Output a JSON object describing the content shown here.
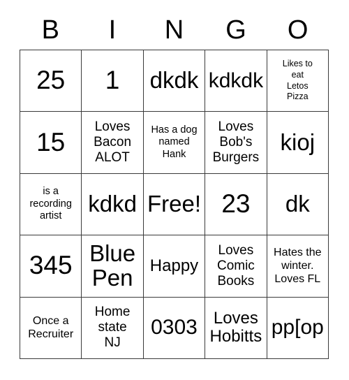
{
  "card": {
    "title": "BINGO",
    "columns": [
      "B",
      "I",
      "N",
      "G",
      "O"
    ],
    "free_space_label": "Free!",
    "colors": {
      "background": "#ffffff",
      "cell_background": "#ffffff",
      "border": "#3a3a3a",
      "text": "#000000"
    },
    "grid": {
      "rows": 5,
      "cols": 5,
      "cells": [
        {
          "text": "25",
          "size": "fs-xxl"
        },
        {
          "text": "1",
          "size": "fs-xxl"
        },
        {
          "text": "dkdk",
          "size": "fs-xl"
        },
        {
          "text": "kdkdk",
          "size": "fs-lg"
        },
        {
          "text": "Likes to\neat\nLetos\nPizza",
          "size": "fs-tiny"
        },
        {
          "text": "15",
          "size": "fs-xxl"
        },
        {
          "text": "Loves\nBacon\nALOT",
          "size": "fs-sm"
        },
        {
          "text": "Has a dog\nnamed\nHank",
          "size": "fs-xxs"
        },
        {
          "text": "Loves\nBob's\nBurgers",
          "size": "fs-sm"
        },
        {
          "text": "kioj",
          "size": "fs-xl"
        },
        {
          "text": "is a\nrecording\nartist",
          "size": "fs-xxs"
        },
        {
          "text": "kdkd",
          "size": "fs-xl"
        },
        {
          "text": "Free!",
          "size": "fs-xl"
        },
        {
          "text": "23",
          "size": "fs-xxl"
        },
        {
          "text": "dk",
          "size": "fs-xl"
        },
        {
          "text": "345",
          "size": "fs-xxl"
        },
        {
          "text": "Blue\nPen",
          "size": "fs-xl"
        },
        {
          "text": "Happy",
          "size": "fs-md"
        },
        {
          "text": "Loves\nComic\nBooks",
          "size": "fs-sm"
        },
        {
          "text": "Hates the\nwinter.\nLoves FL",
          "size": "fs-xs"
        },
        {
          "text": "Once a\nRecruiter",
          "size": "fs-xs"
        },
        {
          "text": "Home\nstate\nNJ",
          "size": "fs-sm"
        },
        {
          "text": "0303",
          "size": "fs-lg"
        },
        {
          "text": "Loves\nHobitts",
          "size": "fs-md"
        },
        {
          "text": "pp[op",
          "size": "fs-lg"
        }
      ]
    }
  }
}
